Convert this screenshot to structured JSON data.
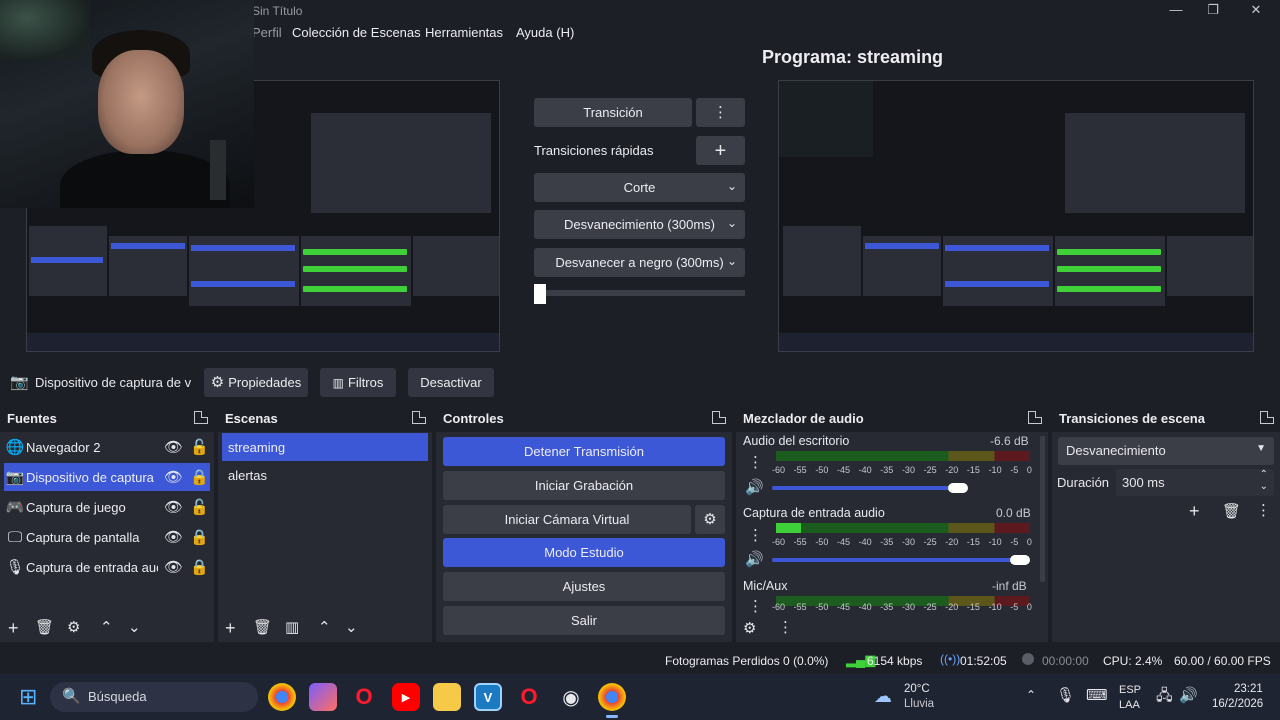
{
  "window": {
    "title": "Sin Título",
    "minimize_icon": "minimize-icon",
    "maximize_icon": "maximize-icon",
    "close_icon": "close-icon"
  },
  "menu": {
    "items": [
      "Perfil",
      "Colección de Escenas",
      "Herramientas",
      "Ayuda (H)"
    ]
  },
  "program": {
    "label": "Programa: streaming"
  },
  "transition_panel": {
    "transition_button": "Transición",
    "quick_transitions_label": "Transiciones rápidas",
    "quick": [
      "Corte",
      "Desvanecimiento (300ms)",
      "Desvanecer a negro (300ms)"
    ]
  },
  "source_toolbar": {
    "source_name": "Dispositivo de captura de v",
    "properties": "Propiedades",
    "filters": "Filtros",
    "deactivate": "Desactivar"
  },
  "docks": {
    "sources": {
      "title": "Fuentes",
      "items": [
        {
          "label": "Navegador 2",
          "icon": "globe-icon",
          "locked": false
        },
        {
          "label": "Dispositivo de captura c",
          "icon": "camera-icon",
          "locked": true,
          "selected": true
        },
        {
          "label": "Captura de juego",
          "icon": "gamepad-icon",
          "locked": false
        },
        {
          "label": "Captura de pantalla",
          "icon": "monitor-icon",
          "locked": true
        },
        {
          "label": "Captura de entrada auc",
          "icon": "mic-icon",
          "locked": true
        }
      ]
    },
    "scenes": {
      "title": "Escenas",
      "items": [
        "streaming",
        "alertas"
      ]
    },
    "controls": {
      "title": "Controles",
      "buttons": [
        "Detener Transmisión",
        "Iniciar Grabación",
        "Iniciar Cámara Virtual",
        "Modo Estudio",
        "Ajustes",
        "Salir"
      ]
    },
    "mixer": {
      "title": "Mezclador de audio",
      "channels": [
        {
          "name": "Audio del escritorio",
          "db": "-6.6 dB",
          "level": 0.0,
          "volume": 0.93
        },
        {
          "name": "Captura de entrada audio",
          "db": "0.0 dB",
          "level": 0.1,
          "volume": 1.0
        },
        {
          "name": "Mic/Aux",
          "db": "-inf dB",
          "level": 0.0,
          "volume": 1.0
        }
      ],
      "scale": [
        "-60",
        "-55",
        "-50",
        "-45",
        "-40",
        "-35",
        "-30",
        "-25",
        "-20",
        "-15",
        "-10",
        "-5",
        "0"
      ]
    },
    "scene_transitions": {
      "title": "Transiciones de escena",
      "selected": "Desvanecimiento",
      "duration_label": "Duración",
      "duration_value": "300 ms"
    }
  },
  "status": {
    "dropped_frames": "Fotogramas Perdidos 0 (0.0%)",
    "bitrate": "6154 kbps",
    "stream_time": "01:52:05",
    "rec_time": "00:00:00",
    "cpu": "CPU: 2.4%",
    "fps": "60.00 / 60.00 FPS"
  },
  "taskbar": {
    "search_placeholder": "Búsqueda",
    "weather_temp": "20°C",
    "weather_desc": "Lluvia",
    "lang_top": "ESP",
    "lang_bottom": "LAA",
    "time": "23:21",
    "date": "16/2/2026"
  },
  "colors": {
    "accent": "#3c58d6",
    "background": "#1d1f26",
    "dock": "#272a33",
    "button": "#3b3e47"
  }
}
